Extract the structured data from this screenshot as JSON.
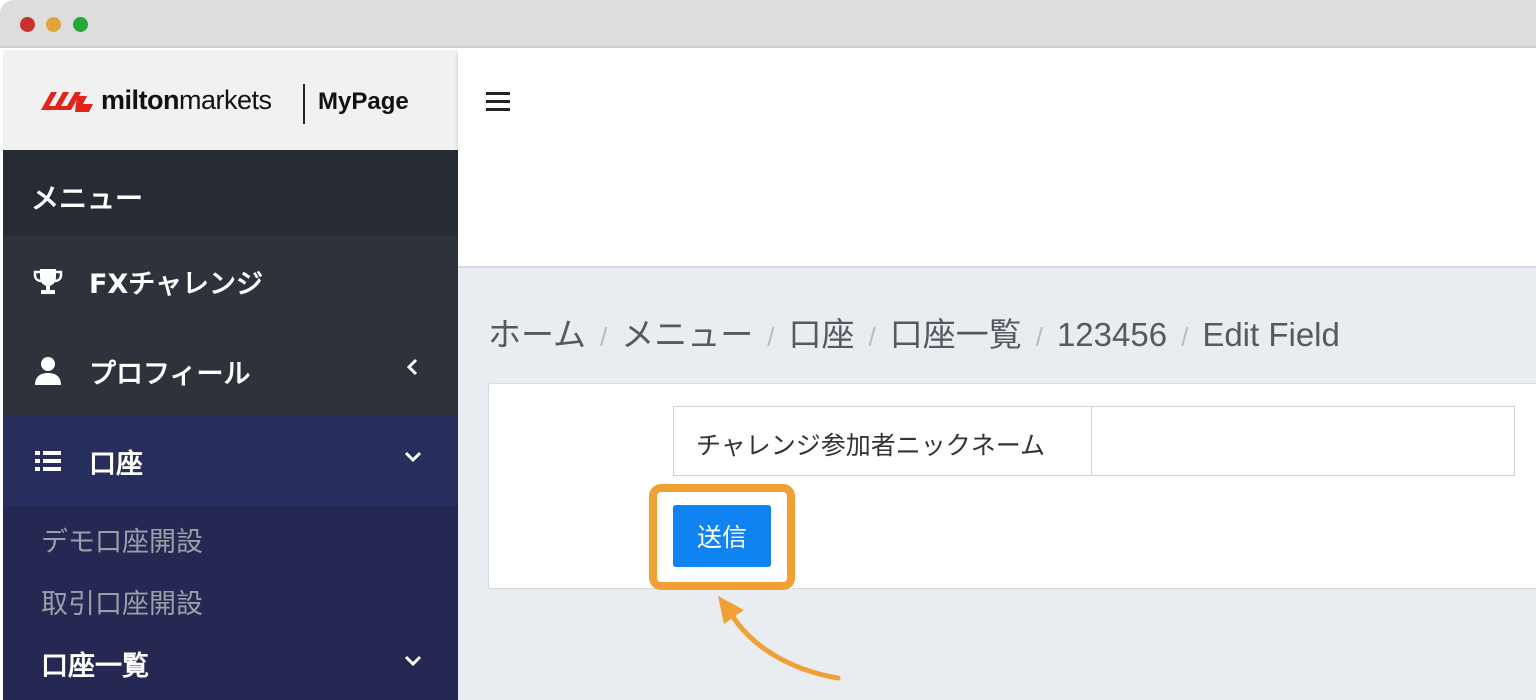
{
  "window": {
    "controls": [
      "close",
      "minimize",
      "maximize"
    ]
  },
  "brand": {
    "name_bold": "milton",
    "name_rest": "markets",
    "page": "MyPage"
  },
  "sidebar": {
    "menu_header": "メニュー",
    "items": [
      {
        "label": "FXチャレンジ",
        "icon": "trophy-icon"
      },
      {
        "label": "プロフィール",
        "icon": "user-icon",
        "chevron": "chevron-left-icon"
      },
      {
        "label": "口座",
        "icon": "list-icon",
        "chevron": "chevron-down-icon"
      }
    ],
    "sub_items": [
      {
        "label": "デモ口座開設"
      },
      {
        "label": "取引口座開設"
      },
      {
        "label": "口座一覧",
        "chevron": "chevron-down-icon"
      }
    ]
  },
  "breadcrumb": [
    "ホーム",
    "メニュー",
    "口座",
    "口座一覧",
    "123456",
    "Edit Field"
  ],
  "form": {
    "field_label": "チャレンジ参加者ニックネーム",
    "field_value": "",
    "submit_label": "送信"
  },
  "colors": {
    "accent": "#1083f2",
    "highlight": "#f0a136",
    "sidebar": "#2d323b",
    "sidebar_active": "#272d5c"
  }
}
